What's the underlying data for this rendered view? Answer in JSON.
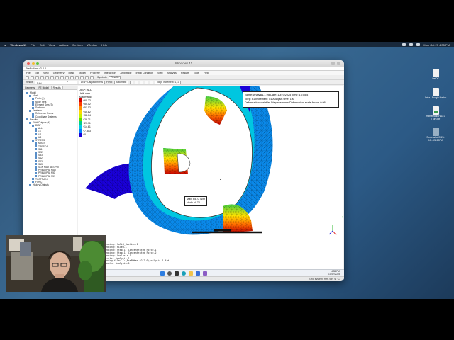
{
  "mac_menubar": {
    "app": "Windows 11",
    "menus": [
      "File",
      "Edit",
      "View",
      "Actions",
      "Devices",
      "Window",
      "Help"
    ],
    "clock": "Mon Oct 27  4:35 PM"
  },
  "desktop": {
    "items": [
      {
        "label": "iaetOC",
        "icon": "document-icon"
      },
      {
        "label": "Anka - Boogie Medoc",
        "icon": "document-icon"
      },
      {
        "label": "mathematica v13.0 TMR.pdf",
        "icon": "spreadsheet-icon"
      },
      {
        "label": "Screenshot 2025-10-...22.50PM",
        "icon": "screenshot-icon"
      }
    ]
  },
  "window": {
    "title": "Windows 11",
    "app_title": "PrePoMax v2.2.0",
    "menus": [
      "File",
      "Edit",
      "View",
      "Geometry",
      "Mesh",
      "Model",
      "Property",
      "Interaction",
      "Amplitude",
      "Initial Condition",
      "Step",
      "Analysis",
      "Results",
      "Tools",
      "Help"
    ],
    "toolbar": {
      "symbols_label": "Symbols:",
      "symbols_value": "Results",
      "result_label": "Result:",
      "result_value": "C:\\PrePoMax-v2.2.0\\test\\analysis-1.frd",
      "field_value": "DISP: Displacements",
      "comp_label": "Field:",
      "comp_value": "Automatic",
      "step_value": "Step, Increment: 1, 1"
    }
  },
  "left_panel": {
    "tabs": [
      "Geometry",
      "FE Model",
      "Results"
    ],
    "active_tab": "Results",
    "tree": [
      {
        "label": "Model",
        "indent": 0
      },
      {
        "label": "Mesh",
        "indent": 1
      },
      {
        "label": "Parts (1)",
        "indent": 2
      },
      {
        "label": "Node Sets",
        "indent": 2
      },
      {
        "label": "Element Sets (3)",
        "indent": 2
      },
      {
        "label": "Surfaces",
        "indent": 2
      },
      {
        "label": "Features",
        "indent": 1
      },
      {
        "label": "Reference Points",
        "indent": 2
      },
      {
        "label": "Coordinate Systems",
        "indent": 2
      },
      {
        "label": "Results",
        "indent": 0
      },
      {
        "label": "Field Outputs (4)",
        "indent": 1
      },
      {
        "label": "DISP",
        "indent": 2
      },
      {
        "label": "ALL",
        "indent": 3
      },
      {
        "label": "U1",
        "indent": 3
      },
      {
        "label": "U2",
        "indent": 3
      },
      {
        "label": "U3",
        "indent": 3
      },
      {
        "label": "STRESS",
        "indent": 2
      },
      {
        "label": "MISES",
        "indent": 3
      },
      {
        "label": "TRESCA",
        "indent": 3
      },
      {
        "label": "S11",
        "indent": 3
      },
      {
        "label": "S22",
        "indent": 3
      },
      {
        "label": "S33",
        "indent": 3
      },
      {
        "label": "S12",
        "indent": 3
      },
      {
        "label": "S23",
        "indent": 3
      },
      {
        "label": "S13",
        "indent": 3
      },
      {
        "label": "SGN MAX ABS PRI",
        "indent": 3
      },
      {
        "label": "PRINCIPAL MAX",
        "indent": 3
      },
      {
        "label": "PRINCIPAL MID",
        "indent": 3
      },
      {
        "label": "PRINCIPAL MIN",
        "indent": 3
      },
      {
        "label": "TOSTRAIN",
        "indent": 2
      },
      {
        "label": "FORC",
        "indent": 2
      },
      {
        "label": "History Outputs",
        "indent": 1
      }
    ]
  },
  "legend": {
    "title": "DISP: ALL",
    "unit": "Unit: mm",
    "mode": "Automatic",
    "values": [
      "+60.72",
      "+55.02",
      "+51.12",
      "+45.82",
      "+38.04",
      "+29.21",
      "+21.91",
      "+14.61",
      "+7.303",
      "+0"
    ],
    "colors": [
      "#d40000",
      "#ff3d00",
      "#ff8f00",
      "#ffd800",
      "#c6f200",
      "#5ce000",
      "#00d08a",
      "#00c8e8",
      "#0084ff",
      "#1a00d8"
    ]
  },
  "info_box": {
    "line1": "Name: Analysis-1.frd   Date: 10/27/2025  Time: 16:05:57",
    "line2": "Step: #1   Increment: #1   Analysis time: 1 s",
    "line3": "Deformation variable: Displacements   Deformation scale factor: 0.96"
  },
  "max_label": {
    "line1": "Max: 65.72 N/m",
    "line2": "Node id: 73"
  },
  "console": {
    "lines": [
      "Creating: Solid_Section-1",
      "Creating: Fixed-1",
      "Creating: Step-1: Concentrated_Force-1",
      "Creating: Step-1: Concentrated_Force-2",
      "Creating: Analysis-1",
      "Results: Analysis-1",
      "Opening file: C:\\PrePoMax-v2.2.0\\Analysis-1.frd",
      "Results: Analysis-1"
    ]
  },
  "taskbar": {
    "clock_time": "4:35 PM",
    "clock_date": "10/27/2025"
  },
  "statusbar": {
    "text": "Grid system: mm, ton, s, °C"
  }
}
